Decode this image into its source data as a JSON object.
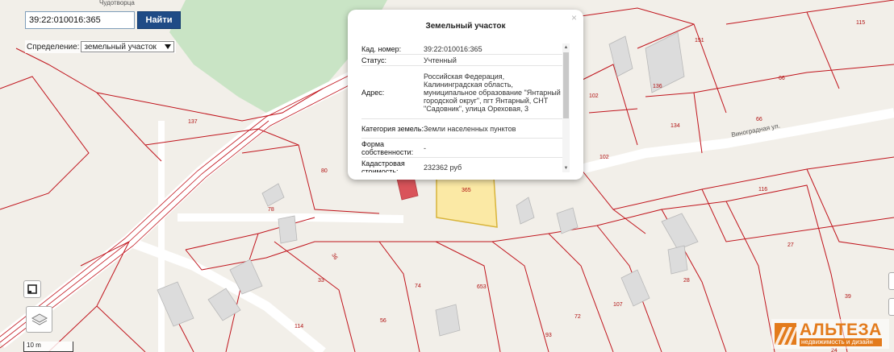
{
  "search": {
    "value": "39:22:010016:365",
    "button_label": "Найти"
  },
  "definition": {
    "label": "Спределение:",
    "selected": "земельный участок"
  },
  "popup": {
    "title": "Земельный участок",
    "close": "×",
    "rows": [
      {
        "key": "Кад. номер:",
        "value": "39:22:010016:365"
      },
      {
        "key": "Статус:",
        "value": "Учтенный"
      },
      {
        "key": "Адрес:",
        "value": "Российская Федерация, Калининградская область, муниципальное образование \"Янтарный городской округ\", пгт Янтарный, СНТ \"Садовник\", улица Ореховая, 3"
      },
      {
        "key": "Категория земель:",
        "value": "Земли населенных пунктов"
      },
      {
        "key": "Форма собственности:",
        "value": "-"
      },
      {
        "key": "Кадастровая стоимость:",
        "value": "232362 руб"
      }
    ]
  },
  "map": {
    "top_label": "Чудотворца",
    "street_label": "Виноградная ул.",
    "selected_parcel": "365",
    "scale": "10 m",
    "colors": {
      "background": "#f2efe9",
      "green_area": "#c9e4c5",
      "boundary": "#c0141c",
      "selected_fill": "#fbe9a5",
      "selected_stroke": "#d8b43a",
      "highlight_building": "#d9545a"
    },
    "parcel_numbers": [
      "137",
      "80",
      "78",
      "36",
      "33",
      "74",
      "653",
      "114",
      "56",
      "93",
      "72",
      "107",
      "28",
      "39",
      "27",
      "116",
      "102",
      "134",
      "66",
      "151",
      "115",
      "102",
      "136",
      "66",
      "24"
    ]
  },
  "logo": {
    "main": "АЛЬТЕЗА",
    "sub": "недвижимость и дизайн"
  },
  "icons": [
    "layers-icon",
    "fullscreen-icon",
    "close-icon",
    "chevron-down-icon",
    "scroll-up-icon",
    "scroll-down-icon"
  ]
}
